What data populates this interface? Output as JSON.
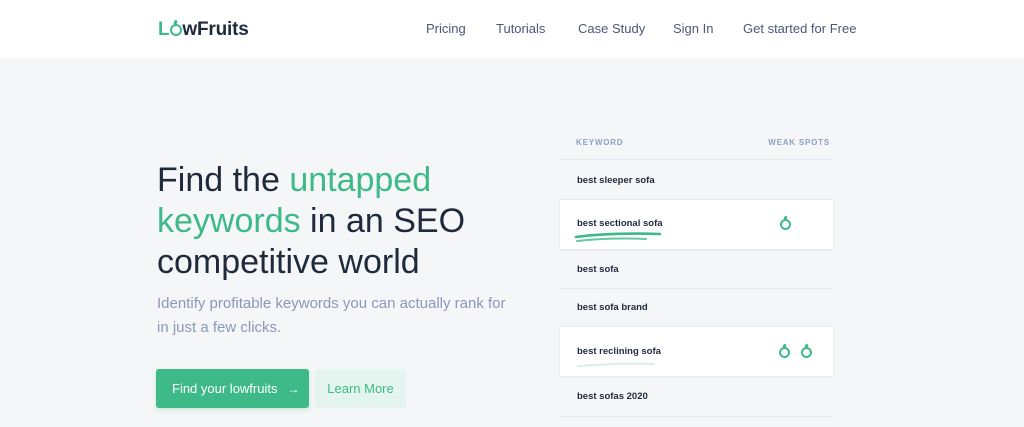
{
  "brand": {
    "name_prefix": "L",
    "name_middle": "w",
    "name_suffix": "Fruits",
    "accent": "#3dba88"
  },
  "nav": {
    "items": [
      "Pricing",
      "Tutorials",
      "Case Study",
      "Sign In",
      "Get started for Free"
    ]
  },
  "hero": {
    "title_part1": "Find the ",
    "title_highlight1": "untapped",
    "title_highlight2": "keywords",
    "title_part2": " in an SEO competitive world",
    "subtitle": "Identify profitable keywords you can actually rank for in just a few clicks.",
    "primary_button": "Find your lowfruits",
    "primary_button_icon": "arrow-right-icon",
    "secondary_button": "Learn More"
  },
  "keyword_table": {
    "header_keyword": "KEYWORD",
    "header_weak_spots": "WEAK SPOTS",
    "rows": [
      {
        "keyword": "best sleeper sofa",
        "weak_spots": 0,
        "highlighted": false
      },
      {
        "keyword": "best sectional sofa",
        "weak_spots": 1,
        "highlighted": true
      },
      {
        "keyword": "best sofa",
        "weak_spots": 0,
        "highlighted": false
      },
      {
        "keyword": "best sofa brand",
        "weak_spots": 0,
        "highlighted": false
      },
      {
        "keyword": "best reclining sofa",
        "weak_spots": 2,
        "highlighted": true
      },
      {
        "keyword": "best sofas 2020",
        "weak_spots": 0,
        "highlighted": false
      }
    ]
  }
}
